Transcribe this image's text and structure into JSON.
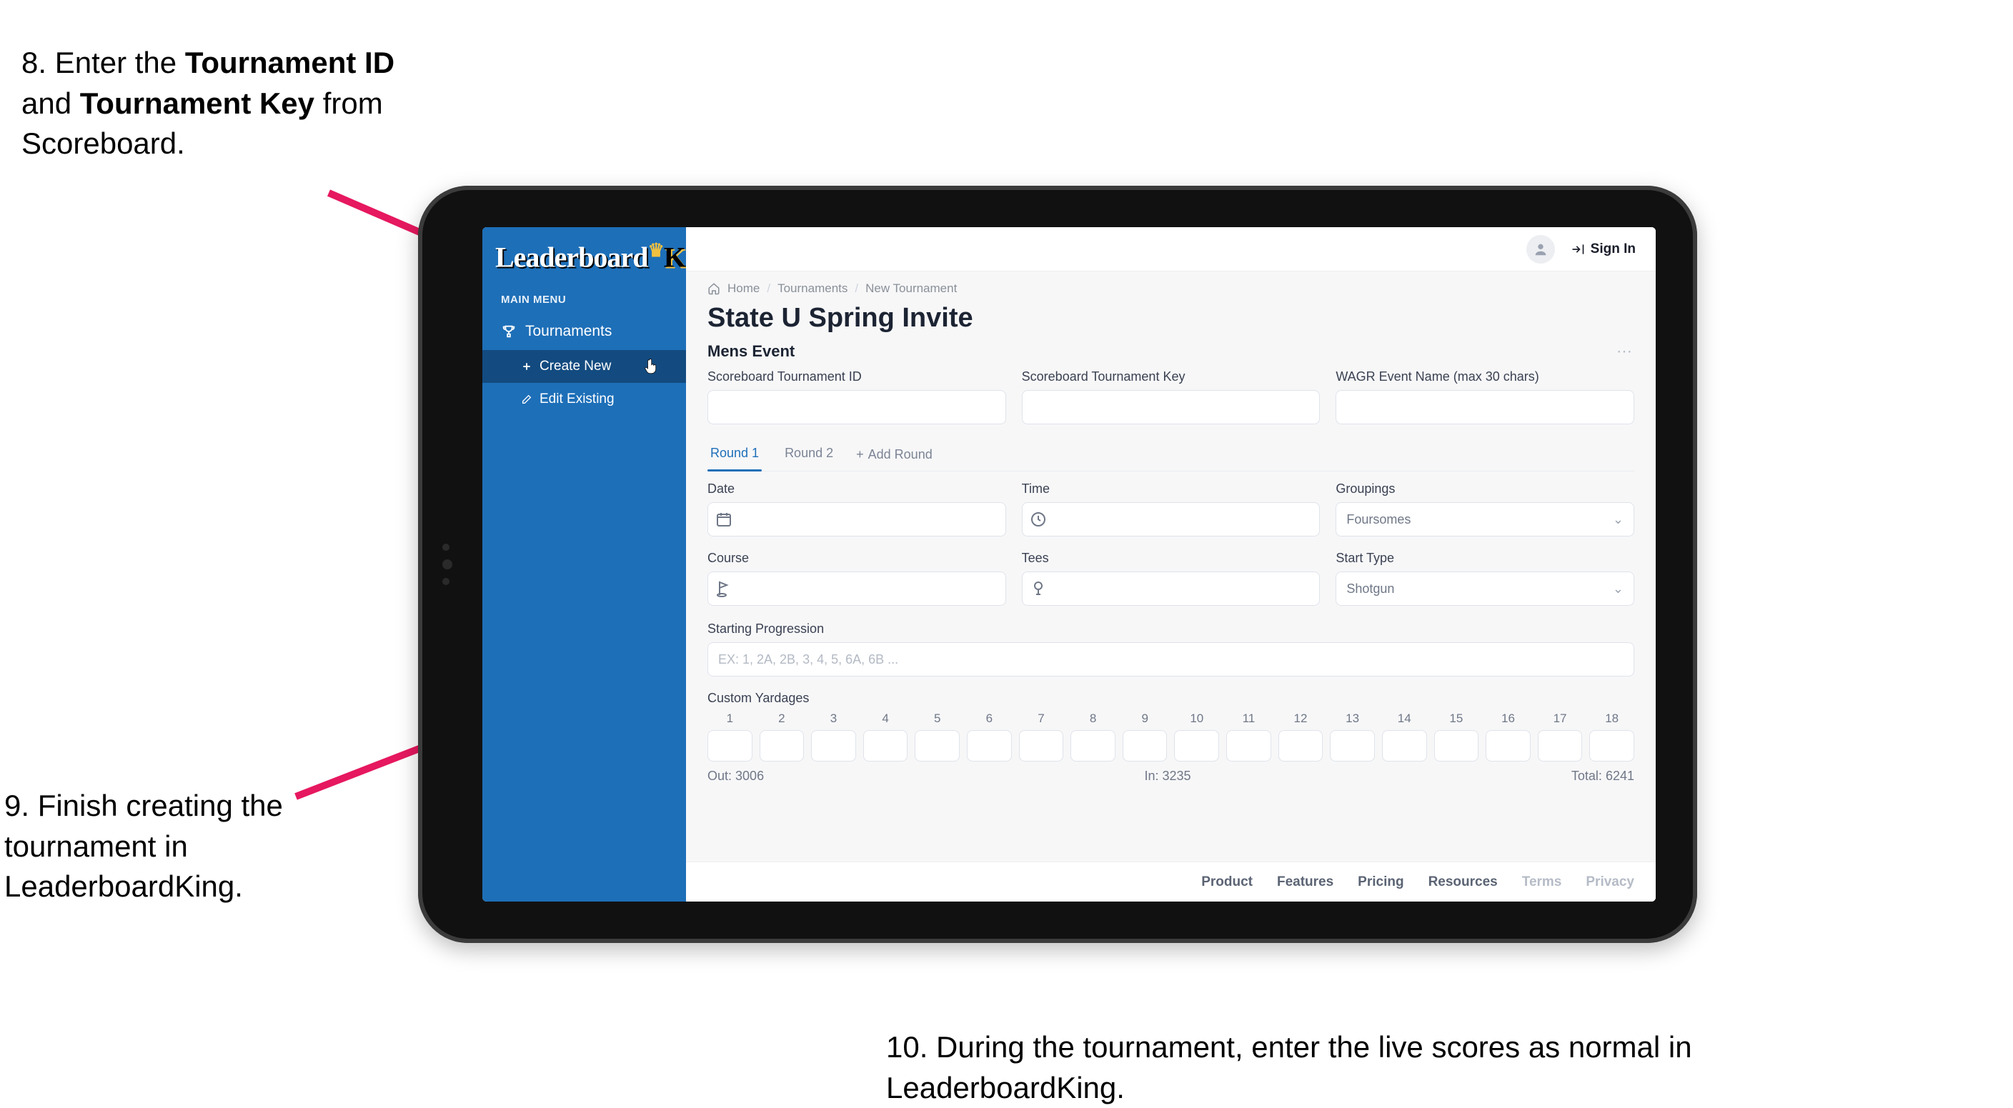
{
  "instructions": {
    "step8": {
      "prefix": "8. Enter the ",
      "b1": "Tournament ID",
      "mid": " and ",
      "b2": "Tournament Key",
      "suffix": " from Scoreboard."
    },
    "step9": "9. Finish creating the tournament in LeaderboardKing.",
    "step10": "10. During the tournament, enter the live scores as normal in LeaderboardKing."
  },
  "colors": {
    "accent": "#e6185f",
    "sidebar": "#1d6fb8"
  },
  "sidebar": {
    "logo": {
      "part1": "Leaderboard",
      "part2": "King"
    },
    "menu_label": "MAIN MENU",
    "tournaments": "Tournaments",
    "create_new": "Create New",
    "edit_existing": "Edit Existing"
  },
  "topbar": {
    "signin": "Sign In"
  },
  "breadcrumbs": {
    "home": "Home",
    "tournaments": "Tournaments",
    "new": "New Tournament"
  },
  "page": {
    "title": "State U Spring Invite",
    "section": "Mens Event"
  },
  "fields": {
    "sb_id": "Scoreboard Tournament ID",
    "sb_key": "Scoreboard Tournament Key",
    "wagr": "WAGR Event Name (max 30 chars)",
    "date": "Date",
    "time": "Time",
    "groupings": "Groupings",
    "course": "Course",
    "tees": "Tees",
    "start_type": "Start Type",
    "starting_prog": "Starting Progression",
    "starting_prog_ph": "EX: 1, 2A, 2B, 3, 4, 5, 6A, 6B ...",
    "custom_yard": "Custom Yardages"
  },
  "selects": {
    "groupings_val": "Foursomes",
    "start_type_val": "Shotgun"
  },
  "tabs": {
    "r1": "Round 1",
    "r2": "Round 2",
    "add": "Add Round"
  },
  "yardage": {
    "holes": [
      "1",
      "2",
      "3",
      "4",
      "5",
      "6",
      "7",
      "8",
      "9",
      "10",
      "11",
      "12",
      "13",
      "14",
      "15",
      "16",
      "17",
      "18"
    ],
    "out_label": "Out:",
    "out_val": "3006",
    "in_label": "In:",
    "in_val": "3235",
    "total_label": "Total:",
    "total_val": "6241"
  },
  "footer": {
    "product": "Product",
    "features": "Features",
    "pricing": "Pricing",
    "resources": "Resources",
    "terms": "Terms",
    "privacy": "Privacy"
  }
}
